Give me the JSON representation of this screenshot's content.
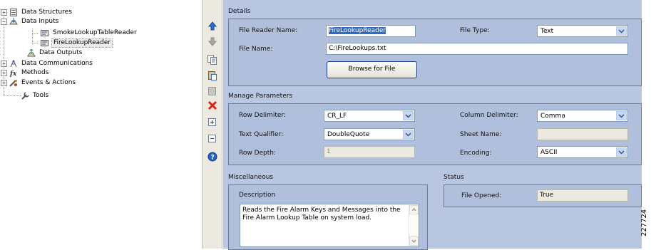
{
  "tree": {
    "items": [
      {
        "label": "Data Structures"
      },
      {
        "label": "Data Inputs"
      },
      {
        "label": "SmokeLookupTableReader"
      },
      {
        "label": "FireLookupReader"
      },
      {
        "label": "Data Outputs"
      },
      {
        "label": "Data Communications"
      },
      {
        "label": "Methods"
      },
      {
        "label": "Events & Actions"
      },
      {
        "label": "Tools"
      }
    ],
    "expander_plus": "+",
    "expander_minus": "−"
  },
  "toolbar": {
    "buttons": [
      "move-up",
      "move-down",
      "copy",
      "paste",
      "cut",
      "delete",
      "expand-all",
      "collapse-all",
      "help"
    ]
  },
  "details": {
    "header": "Details",
    "file_reader_name_label": "File Reader Name:",
    "file_reader_name_value": "FireLookupReader",
    "file_type_label": "File Type:",
    "file_type_value": "Text",
    "file_name_label": "File Name:",
    "file_name_value": "C:\\FireLookups.txt",
    "browse_button": "Browse for File"
  },
  "manage": {
    "header": "Manage Parameters",
    "row_delimiter_label": "Row Delimiter:",
    "row_delimiter_value": "CR_LF",
    "column_delimiter_label": "Column Delimiter:",
    "column_delimiter_value": "Comma",
    "text_qualifier_label": "Text Qualifier:",
    "text_qualifier_value": "DoubleQuote",
    "sheet_name_label": "Sheet Name:",
    "sheet_name_value": "",
    "row_depth_label": "Row Depth:",
    "row_depth_value": "1",
    "encoding_label": "Encoding:",
    "encoding_value": "ASCII"
  },
  "misc": {
    "header": "Miscellaneous",
    "description_label": "Description",
    "description_value": "Reads the Fire Alarm Keys and Messages into the Fire Alarm Lookup Table on system load."
  },
  "status": {
    "header": "Status",
    "file_opened_label": "File Opened:",
    "file_opened_value": "True"
  },
  "figure_id": "227724"
}
